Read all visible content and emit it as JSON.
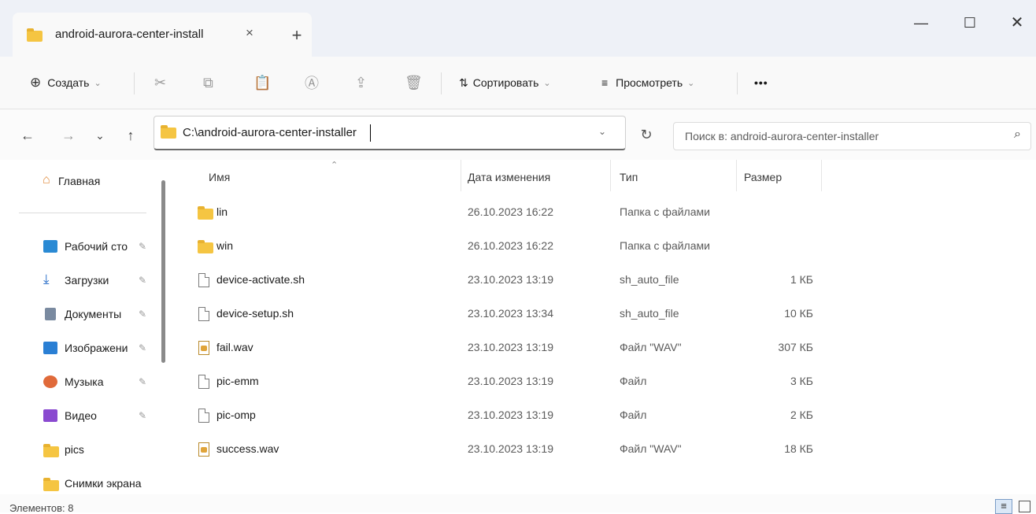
{
  "window": {
    "tab_title": "android-aurora-center-install",
    "tab_close": "×",
    "new_tab": "+",
    "min": "—",
    "max": "☐",
    "close": "✕"
  },
  "toolbar": {
    "create_label": "Создать",
    "sort_label": "Сортировать",
    "view_label": "Просмотреть",
    "more_label": "•••",
    "icons": [
      "plus-circle-icon",
      "cut-icon",
      "copy-icon",
      "paste-icon",
      "rename-icon",
      "share-icon",
      "delete-icon",
      "sort-icon",
      "view-icon"
    ]
  },
  "nav": {
    "back": "←",
    "forward": "→",
    "history": "⌄",
    "up": "↑",
    "address": "C:\\android-aurora-center-installer",
    "refresh": "↻",
    "search_placeholder": "Поиск в: android-aurora-center-installer",
    "search_icon": "⌕"
  },
  "sidebar": {
    "home": "Главная",
    "items": [
      {
        "label": "Рабочий сто",
        "icon": "desktop-icon",
        "color": "#2a8ad4"
      },
      {
        "label": "Загрузки",
        "icon": "downloads-icon",
        "color": "#2a6fc9"
      },
      {
        "label": "Документы",
        "icon": "documents-icon",
        "color": "#7a8aa0"
      },
      {
        "label": "Изображени",
        "icon": "pictures-icon",
        "color": "#2a7fd4"
      },
      {
        "label": "Музыка",
        "icon": "music-icon",
        "color": "#e06a3a"
      },
      {
        "label": "Видео",
        "icon": "video-icon",
        "color": "#8a4ad0"
      },
      {
        "label": "pics",
        "icon": "folder-icon",
        "color": "#f5c542"
      },
      {
        "label": "Снимки экрана",
        "icon": "folder-icon",
        "color": "#f5c542"
      }
    ],
    "pin": "📌"
  },
  "columns": {
    "name": "Имя",
    "date": "Дата изменения",
    "type": "Тип",
    "size": "Размер"
  },
  "files": [
    {
      "name": "lin",
      "date": "26.10.2023 16:22",
      "type": "Папка с файлами",
      "size": "",
      "kind": "folder"
    },
    {
      "name": "win",
      "date": "26.10.2023 16:22",
      "type": "Папка с файлами",
      "size": "",
      "kind": "folder"
    },
    {
      "name": "device-activate.sh",
      "date": "23.10.2023 13:19",
      "type": "sh_auto_file",
      "size": "1 КБ",
      "kind": "doc"
    },
    {
      "name": "device-setup.sh",
      "date": "23.10.2023 13:34",
      "type": "sh_auto_file",
      "size": "10 КБ",
      "kind": "doc"
    },
    {
      "name": "fail.wav",
      "date": "23.10.2023 13:19",
      "type": "Файл \"WAV\"",
      "size": "307 КБ",
      "kind": "wav"
    },
    {
      "name": "pic-emm",
      "date": "23.10.2023 13:19",
      "type": "Файл",
      "size": "3 КБ",
      "kind": "doc"
    },
    {
      "name": "pic-omp",
      "date": "23.10.2023 13:19",
      "type": "Файл",
      "size": "2 КБ",
      "kind": "doc"
    },
    {
      "name": "success.wav",
      "date": "23.10.2023 13:19",
      "type": "Файл \"WAV\"",
      "size": "18 КБ",
      "kind": "wav"
    }
  ],
  "status": {
    "count_text": "Элементов: 8"
  }
}
